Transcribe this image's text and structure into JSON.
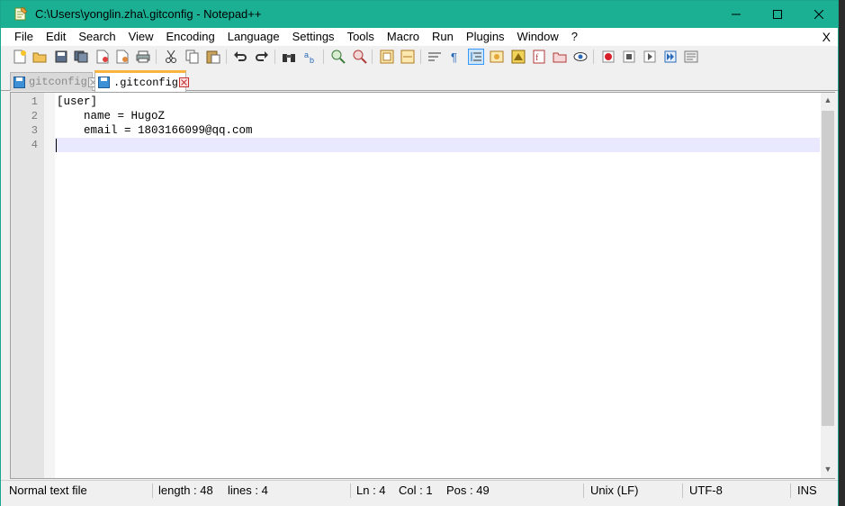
{
  "window": {
    "title": "C:\\Users\\yonglin.zha\\.gitconfig - Notepad++",
    "title_bar_color": "#1bb094"
  },
  "menu": {
    "items": [
      "File",
      "Edit",
      "Search",
      "View",
      "Encoding",
      "Language",
      "Settings",
      "Tools",
      "Macro",
      "Run",
      "Plugins",
      "Window",
      "?"
    ],
    "close_doc": "X"
  },
  "tabs": [
    {
      "label": "gitconfig",
      "active": false
    },
    {
      "label": ".gitconfig",
      "active": true
    }
  ],
  "editor": {
    "line_numbers": [
      "1",
      "2",
      "3",
      "4"
    ],
    "lines": [
      "[user]",
      "    name = HugoZ",
      "    email = 1803166099@qq.com",
      ""
    ],
    "current_line": 4
  },
  "status": {
    "file_type": "Normal text file",
    "length": "length : 48",
    "lines": "lines : 4",
    "ln": "Ln : 4",
    "col": "Col : 1",
    "pos": "Pos : 49",
    "eol": "Unix (LF)",
    "encoding": "UTF-8",
    "mode": "INS"
  }
}
